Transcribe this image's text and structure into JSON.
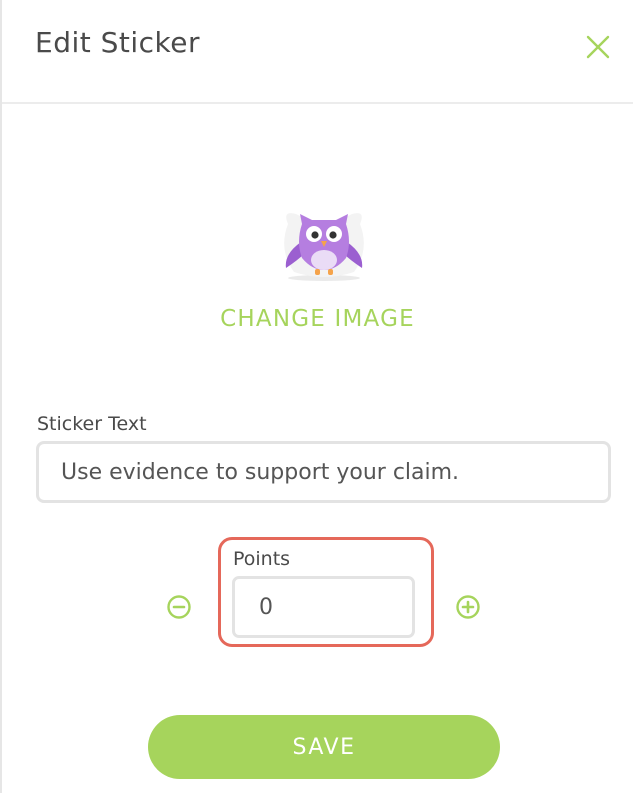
{
  "dialog": {
    "title": "Edit Sticker",
    "close_icon": "close-icon"
  },
  "sticker": {
    "image_icon": "owl-sticker",
    "change_image_label": "CHANGE IMAGE"
  },
  "sticker_text": {
    "label": "Sticker Text",
    "value": "Use evidence to support your claim."
  },
  "points": {
    "label": "Points",
    "value": "0",
    "decrement_icon": "minus-circle-icon",
    "increment_icon": "plus-circle-icon"
  },
  "actions": {
    "save_label": "SAVE"
  },
  "colors": {
    "accent": "#a6d45c",
    "highlight": "#e5685a",
    "text": "#4a4a4a",
    "owl": "#b57ee0"
  }
}
